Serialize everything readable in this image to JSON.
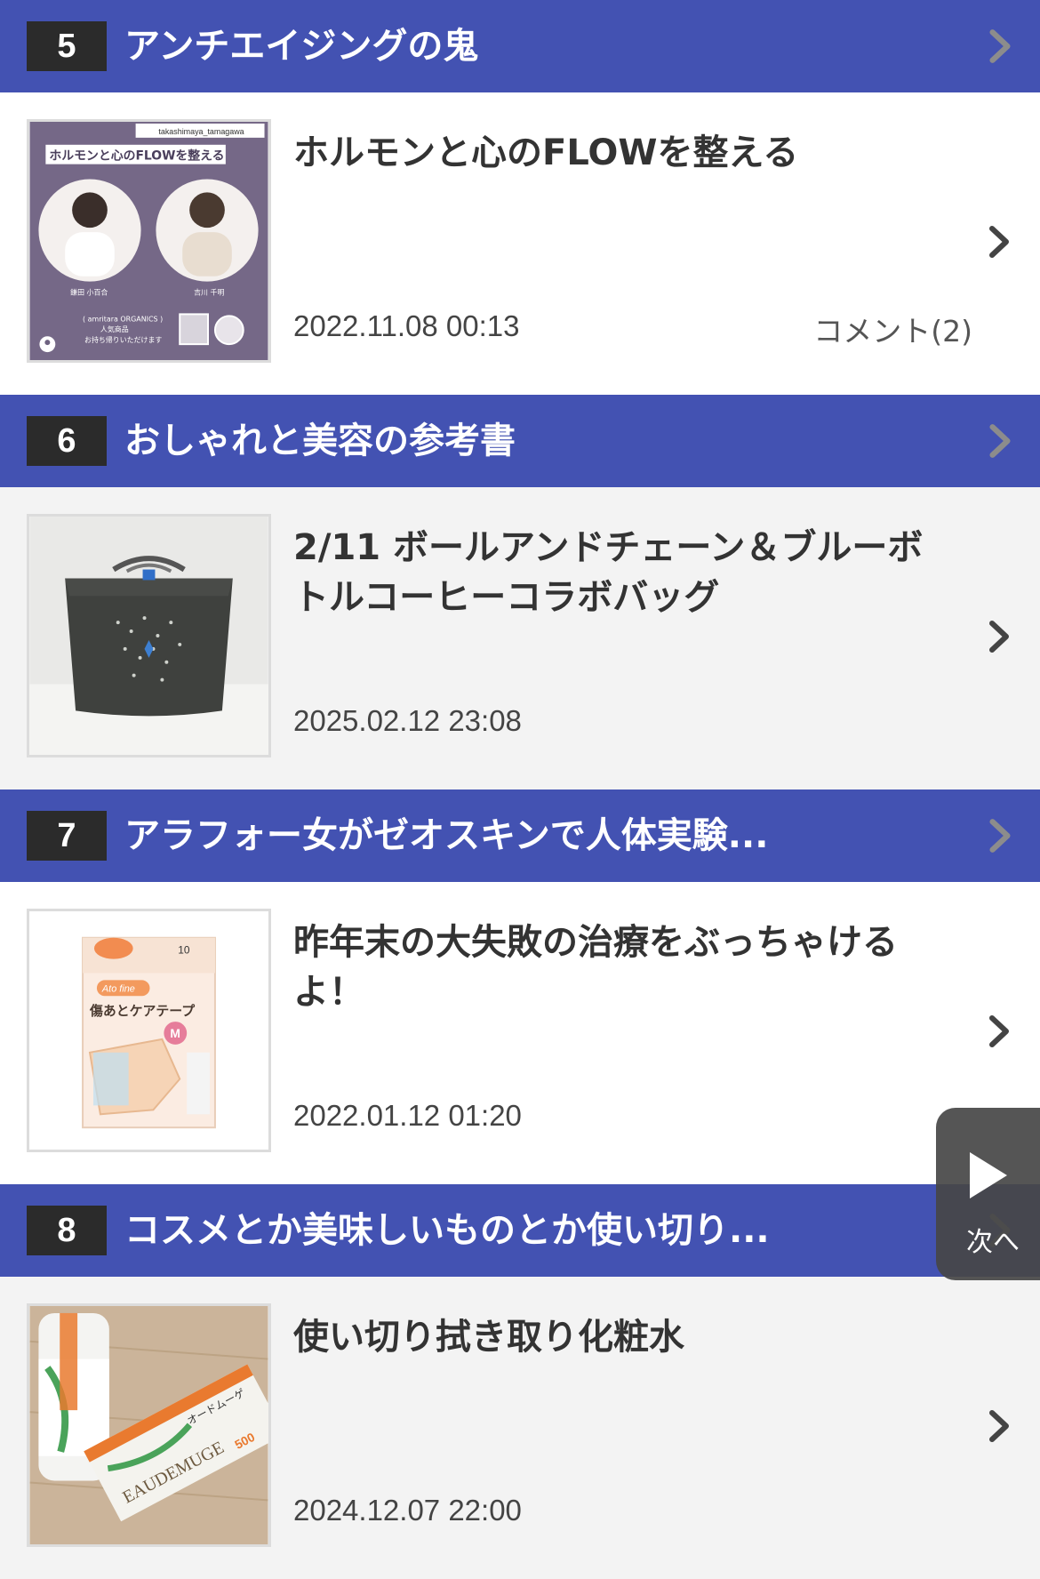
{
  "blogs": [
    {
      "rank": "5",
      "title": "アンチエイジングの鬼",
      "entry": {
        "title": "ホルモンと心のFLOWを整える",
        "date": "2022.11.08 00:13",
        "comment": "コメント(2)"
      },
      "thumb_text": {
        "account": "takashimaya_tamagawa",
        "banner": "ホルモンと心のFLOWを整える",
        "person1": "鎌田 小百合",
        "person2": "吉川 千明",
        "caption1": "( amritara ORGANICS )",
        "caption2": "人気商品",
        "caption3": "お持ち帰りいただけます"
      }
    },
    {
      "rank": "6",
      "title": "おしゃれと美容の参考書",
      "entry": {
        "title": "2/11 ボールアンドチェーン＆ブルーボトルコーヒーコラボバッグ",
        "date": "2025.02.12 23:08",
        "comment": ""
      }
    },
    {
      "rank": "7",
      "title": "アラフォー女がゼオスキンで人体実験...",
      "entry": {
        "title": "昨年末の大失敗の治療をぶっちゃけるよ！",
        "date": "2022.01.12 01:20",
        "comment": ""
      },
      "thumb_text": {
        "brand": "Ato fine",
        "product": "傷あとケアテープ",
        "size": "M",
        "count": "10"
      }
    },
    {
      "rank": "8",
      "title": "コスメとか美味しいものとか使い切り...",
      "entry": {
        "title": "使い切り拭き取り化粧水",
        "date": "2024.12.07 22:00",
        "comment": ""
      },
      "thumb_text": {
        "brand": "EAUDEMUGE",
        "label": "オードムーゲ",
        "volume": "500"
      }
    }
  ],
  "next_button": {
    "label": "次へ"
  },
  "colors": {
    "header_bg": "#4352b2",
    "badge_bg": "#2b2b2b",
    "alt_row_bg": "#f3f3f3"
  }
}
